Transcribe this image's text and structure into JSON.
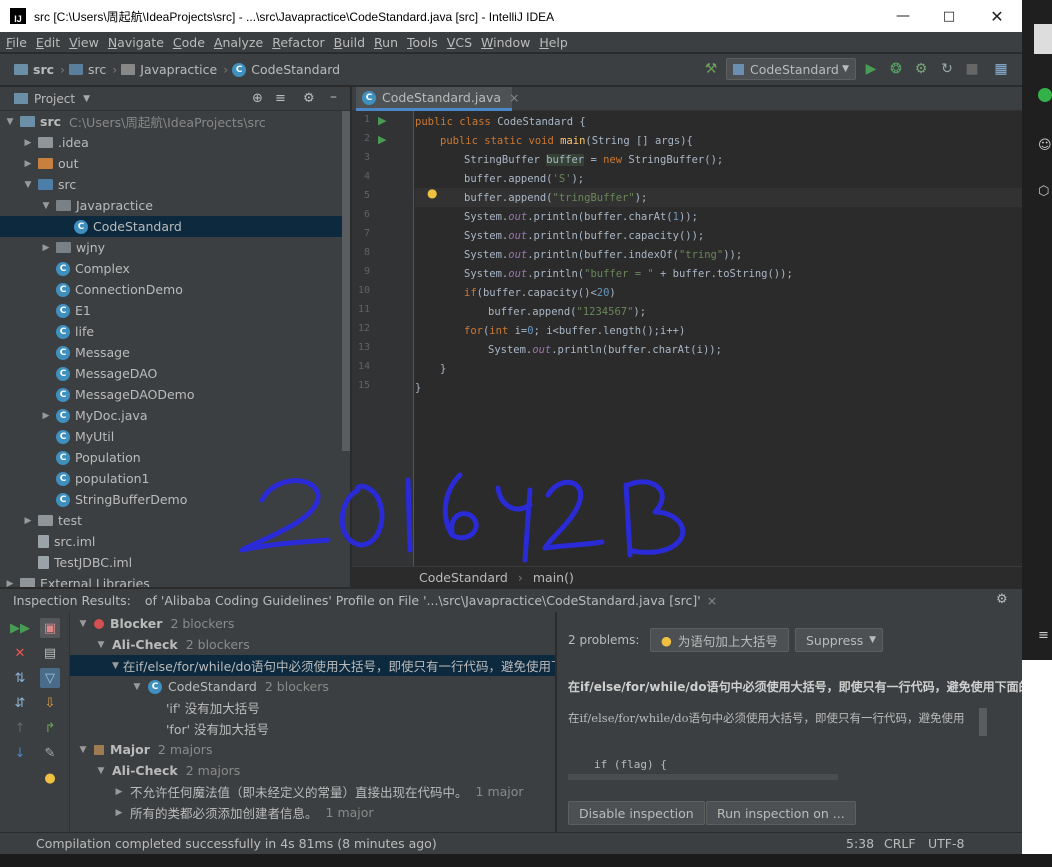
{
  "window": {
    "title": "src [C:\\Users\\周起航\\IdeaProjects\\src] - ...\\src\\Javapractice\\CodeStandard.java [src] - IntelliJ IDEA",
    "logo": "IJ"
  },
  "menu": [
    "File",
    "Edit",
    "View",
    "Navigate",
    "Code",
    "Analyze",
    "Refactor",
    "Build",
    "Run",
    "Tools",
    "VCS",
    "Window",
    "Help"
  ],
  "breadcrumb": [
    "src",
    "src",
    "Javapractice",
    "CodeStandard"
  ],
  "run_config": "CodeStandard",
  "project": {
    "header": "Project",
    "tree": [
      {
        "label": "src",
        "extra": "C:\\Users\\周起航\\IdeaProjects\\src",
        "kind": "module",
        "level": 0,
        "arrow": "▼"
      },
      {
        "label": ".idea",
        "kind": "folder-grey",
        "level": 1,
        "arrow": "▶"
      },
      {
        "label": "out",
        "kind": "folder-orange",
        "level": 1,
        "arrow": "▶"
      },
      {
        "label": "src",
        "kind": "folder-blue",
        "level": 1,
        "arrow": "▼"
      },
      {
        "label": "Javapractice",
        "kind": "package",
        "level": 2,
        "arrow": "▼"
      },
      {
        "label": "CodeStandard",
        "kind": "class",
        "level": 3,
        "arrow": "",
        "selected": true
      },
      {
        "label": "wjny",
        "kind": "package",
        "level": 2,
        "arrow": "▶"
      },
      {
        "label": "Complex",
        "kind": "class",
        "level": 2,
        "arrow": ""
      },
      {
        "label": "ConnectionDemo",
        "kind": "class",
        "level": 2,
        "arrow": ""
      },
      {
        "label": "E1",
        "kind": "class",
        "level": 2,
        "arrow": ""
      },
      {
        "label": "life",
        "kind": "class",
        "level": 2,
        "arrow": ""
      },
      {
        "label": "Message",
        "kind": "class",
        "level": 2,
        "arrow": ""
      },
      {
        "label": "MessageDAO",
        "kind": "class",
        "level": 2,
        "arrow": ""
      },
      {
        "label": "MessageDAODemo",
        "kind": "class",
        "level": 2,
        "arrow": ""
      },
      {
        "label": "MyDoc.java",
        "kind": "class",
        "level": 2,
        "arrow": "▶"
      },
      {
        "label": "MyUtil",
        "kind": "class",
        "level": 2,
        "arrow": ""
      },
      {
        "label": "Population",
        "kind": "class",
        "level": 2,
        "arrow": ""
      },
      {
        "label": "population1",
        "kind": "class",
        "level": 2,
        "arrow": ""
      },
      {
        "label": "StringBufferDemo",
        "kind": "class",
        "level": 2,
        "arrow": ""
      },
      {
        "label": "test",
        "kind": "folder-grey",
        "level": 1,
        "arrow": "▶"
      },
      {
        "label": "src.iml",
        "kind": "file",
        "level": 1,
        "arrow": ""
      },
      {
        "label": "TestJDBC.iml",
        "kind": "file",
        "level": 1,
        "arrow": ""
      },
      {
        "label": "External Libraries",
        "kind": "lib",
        "level": 0,
        "arrow": "▶"
      }
    ]
  },
  "editor": {
    "tab": "CodeStandard.java",
    "breadcrumb": [
      "CodeStandard",
      "main()"
    ],
    "line_numbers": [
      "1",
      "2",
      "3",
      "4",
      "5",
      "6",
      "7",
      "8",
      "9",
      "10",
      "11",
      "12",
      "13",
      "14",
      "15"
    ]
  },
  "inspection": {
    "title_label": "Inspection Results:",
    "title_tab": "of 'Alibaba Coding Guidelines' Profile on File '...\\src\\Javapractice\\CodeStandard.java [src]'",
    "tree": [
      {
        "label": "Blocker",
        "count": "2 blockers",
        "level": 0,
        "arrow": "▼",
        "bold": true,
        "icon": "blocker"
      },
      {
        "label": "Ali-Check",
        "count": "2 blockers",
        "level": 1,
        "arrow": "▼",
        "bold": true
      },
      {
        "label": "在if/else/for/while/do语句中必须使用大括号，即使只有一行代码，避免使用下面",
        "count": "",
        "level": 2,
        "arrow": "▼",
        "selected": true
      },
      {
        "label": "CodeStandard",
        "count": "2 blockers",
        "level": 3,
        "arrow": "▼",
        "icon": "class"
      },
      {
        "label": "'if' 没有加大括号",
        "count": "",
        "level": 4,
        "arrow": ""
      },
      {
        "label": "'for' 没有加大括号",
        "count": "",
        "level": 4,
        "arrow": ""
      },
      {
        "label": "Major",
        "count": "2 majors",
        "level": 0,
        "arrow": "▼",
        "bold": true,
        "icon": "major"
      },
      {
        "label": "Ali-Check",
        "count": "2 majors",
        "level": 1,
        "arrow": "▼",
        "bold": true
      },
      {
        "label": "不允许任何魔法值（即未经定义的常量）直接出现在代码中。",
        "count": "1 major",
        "level": 2,
        "arrow": "▶"
      },
      {
        "label": "所有的类都必须添加创建者信息。",
        "count": "1 major",
        "level": 2,
        "arrow": "▶"
      }
    ],
    "detail": {
      "problems": "2 problems:",
      "fix_button": "为语句加上大括号",
      "suppress": "Suppress",
      "heading": "在if/else/for/while/do语句中必须使用大括号，即使只有一行代码，避免使用下面的",
      "desc": "在if/else/for/while/do语句中必须使用大括号，即使只有一行代码，避免使用",
      "code_snippet": "if (flag) {",
      "disable_button": "Disable inspection",
      "run_button": "Run inspection on ..."
    }
  },
  "status": {
    "message": "Compilation completed successfully in 4s 81ms (8 minutes ago)",
    "position": "5:38",
    "line_sep": "CRLF",
    "encoding": "UTF-8"
  },
  "colors": {
    "accent": "#4a88c7",
    "selection": "#0d293e",
    "run": "#499c54",
    "keyword": "#cc7832",
    "string": "#6a8759"
  }
}
